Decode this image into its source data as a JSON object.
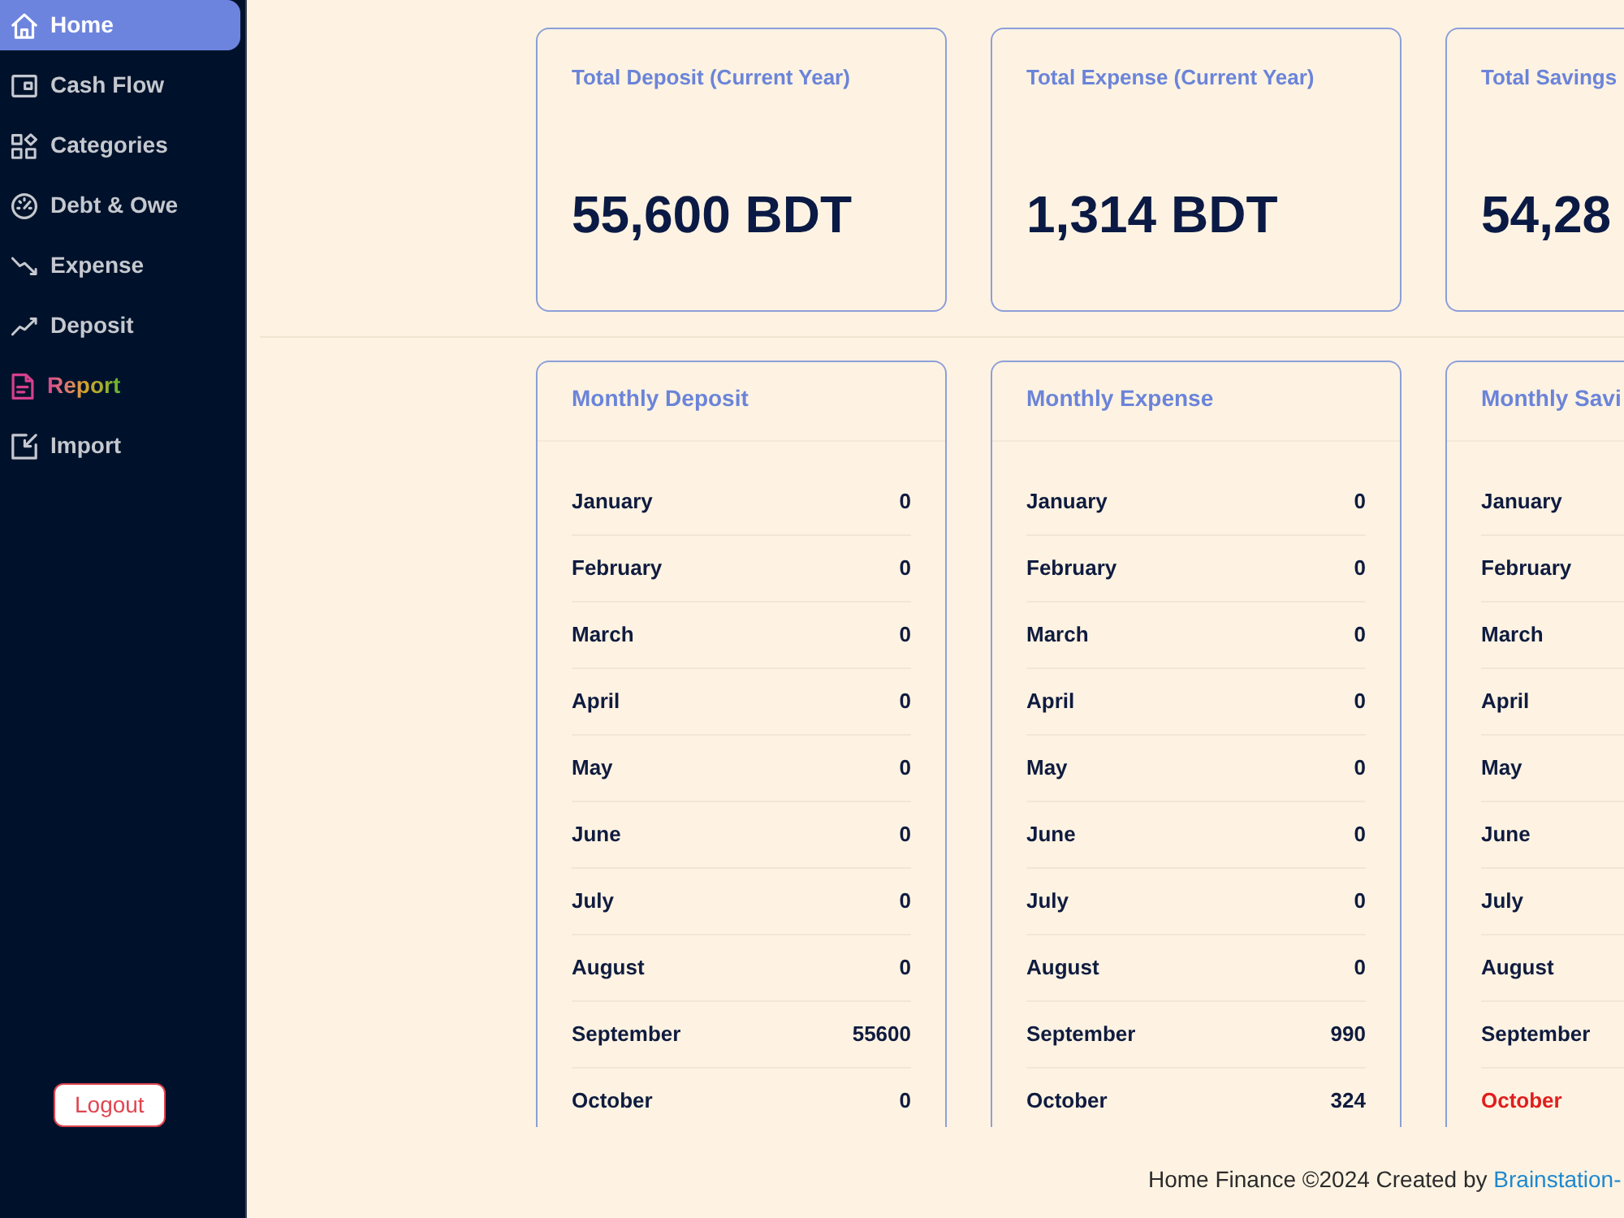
{
  "sidebar": {
    "items": [
      {
        "label": "Home",
        "selected": true,
        "highlight": false
      },
      {
        "label": "Cash Flow",
        "selected": false,
        "highlight": false
      },
      {
        "label": "Categories",
        "selected": false,
        "highlight": false
      },
      {
        "label": "Debt & Owe",
        "selected": false,
        "highlight": false
      },
      {
        "label": "Expense",
        "selected": false,
        "highlight": false
      },
      {
        "label": "Deposit",
        "selected": false,
        "highlight": false
      },
      {
        "label": "Report",
        "selected": false,
        "highlight": true
      },
      {
        "label": "Import",
        "selected": false,
        "highlight": false
      }
    ],
    "logout": "Logout"
  },
  "summary_cards": [
    {
      "title": "Total Deposit (Current Year)",
      "value": "55,600 BDT"
    },
    {
      "title": "Total Expense (Current Year)",
      "value": "1,314 BDT"
    },
    {
      "title": "Total Savings",
      "value": "54,28"
    }
  ],
  "monthly_cards": [
    {
      "title": "Monthly Deposit",
      "rows": [
        {
          "month": "January",
          "value": "0",
          "negative": false
        },
        {
          "month": "February",
          "value": "0",
          "negative": false
        },
        {
          "month": "March",
          "value": "0",
          "negative": false
        },
        {
          "month": "April",
          "value": "0",
          "negative": false
        },
        {
          "month": "May",
          "value": "0",
          "negative": false
        },
        {
          "month": "June",
          "value": "0",
          "negative": false
        },
        {
          "month": "July",
          "value": "0",
          "negative": false
        },
        {
          "month": "August",
          "value": "0",
          "negative": false
        },
        {
          "month": "September",
          "value": "55600",
          "negative": false
        },
        {
          "month": "October",
          "value": "0",
          "negative": false
        }
      ]
    },
    {
      "title": "Monthly Expense",
      "rows": [
        {
          "month": "January",
          "value": "0",
          "negative": false
        },
        {
          "month": "February",
          "value": "0",
          "negative": false
        },
        {
          "month": "March",
          "value": "0",
          "negative": false
        },
        {
          "month": "April",
          "value": "0",
          "negative": false
        },
        {
          "month": "May",
          "value": "0",
          "negative": false
        },
        {
          "month": "June",
          "value": "0",
          "negative": false
        },
        {
          "month": "July",
          "value": "0",
          "negative": false
        },
        {
          "month": "August",
          "value": "0",
          "negative": false
        },
        {
          "month": "September",
          "value": "990",
          "negative": false
        },
        {
          "month": "October",
          "value": "324",
          "negative": false
        }
      ]
    },
    {
      "title": "Monthly Savi",
      "rows": [
        {
          "month": "January",
          "negative": false
        },
        {
          "month": "February",
          "negative": false
        },
        {
          "month": "March",
          "negative": false
        },
        {
          "month": "April",
          "negative": false
        },
        {
          "month": "May",
          "negative": false
        },
        {
          "month": "June",
          "negative": false
        },
        {
          "month": "July",
          "negative": false
        },
        {
          "month": "August",
          "negative": false
        },
        {
          "month": "September",
          "negative": false
        },
        {
          "month": "October",
          "negative": true
        }
      ]
    }
  ],
  "footer": {
    "text": "Home Finance ©2024 Created by",
    "link": "Brainstation-"
  }
}
